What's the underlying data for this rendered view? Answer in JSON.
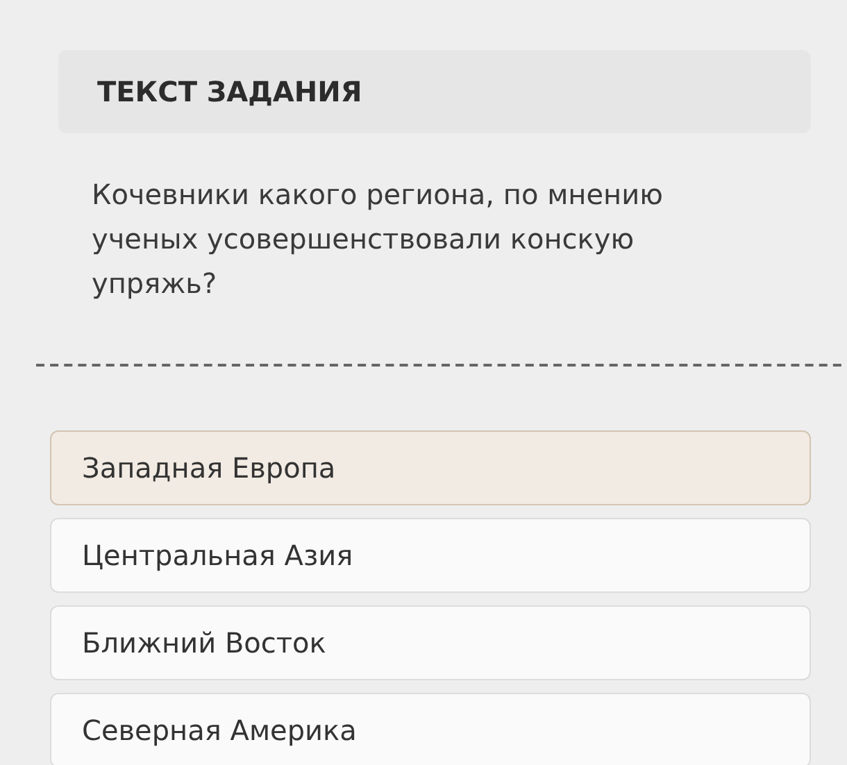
{
  "task_header": {
    "title": "ТЕКСТ ЗАДАНИЯ"
  },
  "question": "Кочевники какого региона, по мнению ученых усовершенствовали конскую упряжь?",
  "options": [
    {
      "label": "Западная Европа",
      "selected": true
    },
    {
      "label": "Центральная Азия",
      "selected": false
    },
    {
      "label": "Ближний Восток",
      "selected": false
    },
    {
      "label": "Северная Америка",
      "selected": false
    }
  ]
}
